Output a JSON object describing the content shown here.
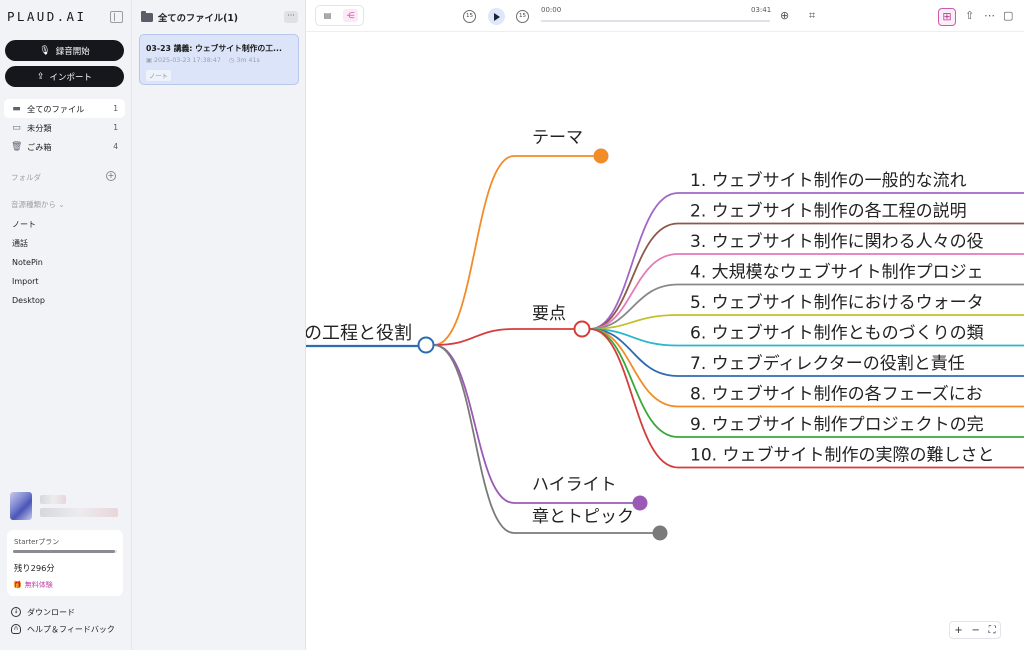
{
  "sidebar": {
    "logo": "PLAUD.AI",
    "record_label": "録音開始",
    "import_label": "インポート",
    "nav": [
      {
        "label": "全てのファイル",
        "count": "1",
        "icon": "folder-icon"
      },
      {
        "label": "未分類",
        "count": "1",
        "icon": "inbox-icon"
      },
      {
        "label": "ごみ箱",
        "count": "4",
        "icon": "trash-icon"
      }
    ],
    "folder_label": "フォルダ",
    "source_label": "音源種類から",
    "sources": [
      "ノート",
      "通話",
      "NotePin",
      "Import",
      "Desktop"
    ],
    "plan": {
      "name": "Starterプラン",
      "usage_fraction": 0.98,
      "remaining": "残り296分",
      "trial": "無料体験"
    },
    "footer": {
      "download": "ダウンロード",
      "help": "ヘルプ＆フィードバック"
    }
  },
  "filelist": {
    "title": "全てのファイル(1)",
    "more": "···",
    "file": {
      "title": "03-23 講義: ウェブサイト制作の工...",
      "date": "2025-03-23 17:38:47",
      "duration": "3m 41s",
      "tag": "ノート"
    }
  },
  "player": {
    "current_time": "00:00",
    "total_time": "03:41",
    "rewind_label": "15",
    "forward_label": "15"
  },
  "mindmap": {
    "root": "の工程と役割",
    "branches": [
      {
        "label": "テーマ",
        "color": "#f28c28"
      },
      {
        "label": "要点",
        "color": "#d63c3c",
        "children": [
          {
            "label": "1. ウェブサイト制作の一般的な流れ",
            "color": "#a066c8"
          },
          {
            "label": "2. ウェブサイト制作の各工程の説明",
            "color": "#8a5a48"
          },
          {
            "label": "3. ウェブサイト制作に関わる人々の役",
            "color": "#e57ab8"
          },
          {
            "label": "4. 大規模なウェブサイト制作プロジェ",
            "color": "#888888"
          },
          {
            "label": "5. ウェブサイト制作におけるウォータ",
            "color": "#c2c02b"
          },
          {
            "label": "6. ウェブサイト制作とものづくりの類",
            "color": "#28b8cc"
          },
          {
            "label": "7. ウェブディレクターの役割と責任",
            "color": "#2e6cb0"
          },
          {
            "label": "8. ウェブサイト制作の各フェーズにお",
            "color": "#f28c28"
          },
          {
            "label": "9. ウェブサイト制作プロジェクトの完",
            "color": "#3aa83a"
          },
          {
            "label": "10. ウェブサイト制作の実際の難しさと",
            "color": "#d63c3c"
          }
        ]
      },
      {
        "label": "ハイライト",
        "color": "#9b59b6"
      },
      {
        "label": "章とトピック",
        "color": "#7a7a7a"
      }
    ]
  },
  "zoom": {
    "in": "+",
    "out": "−",
    "fit": "⛶"
  }
}
